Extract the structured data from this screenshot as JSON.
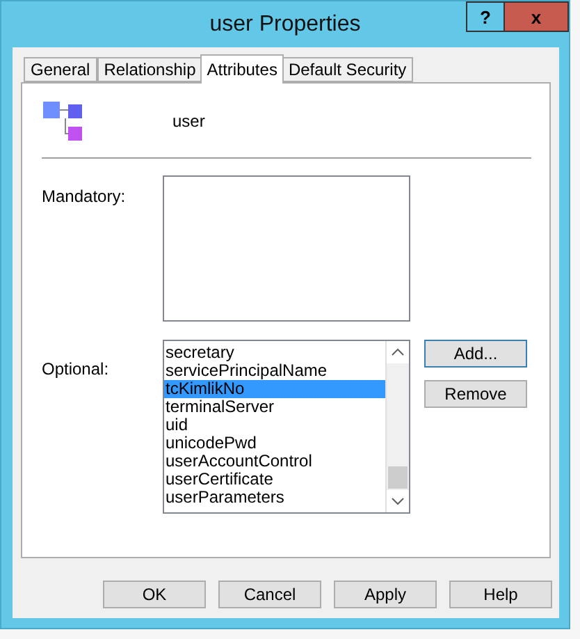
{
  "window": {
    "title": "user Properties",
    "help": "?",
    "close": "x"
  },
  "tabs": [
    {
      "label": "General",
      "selected": false
    },
    {
      "label": "Relationship",
      "selected": false
    },
    {
      "label": "Attributes",
      "selected": true
    },
    {
      "label": "Default Security",
      "selected": false
    }
  ],
  "class_name": "user",
  "mandatory": {
    "label": "Mandatory:"
  },
  "optional": {
    "label": "Optional:",
    "items": [
      {
        "text": "secretary",
        "selected": false
      },
      {
        "text": "servicePrincipalName",
        "selected": false
      },
      {
        "text": "tcKimlikNo",
        "selected": true
      },
      {
        "text": "terminalServer",
        "selected": false
      },
      {
        "text": "uid",
        "selected": false
      },
      {
        "text": "unicodePwd",
        "selected": false
      },
      {
        "text": "userAccountControl",
        "selected": false
      },
      {
        "text": "userCertificate",
        "selected": false
      },
      {
        "text": "userParameters",
        "selected": false
      }
    ]
  },
  "side_buttons": [
    "Add...",
    "Remove"
  ],
  "buttons": [
    "OK",
    "Cancel",
    "Apply",
    "Help"
  ]
}
